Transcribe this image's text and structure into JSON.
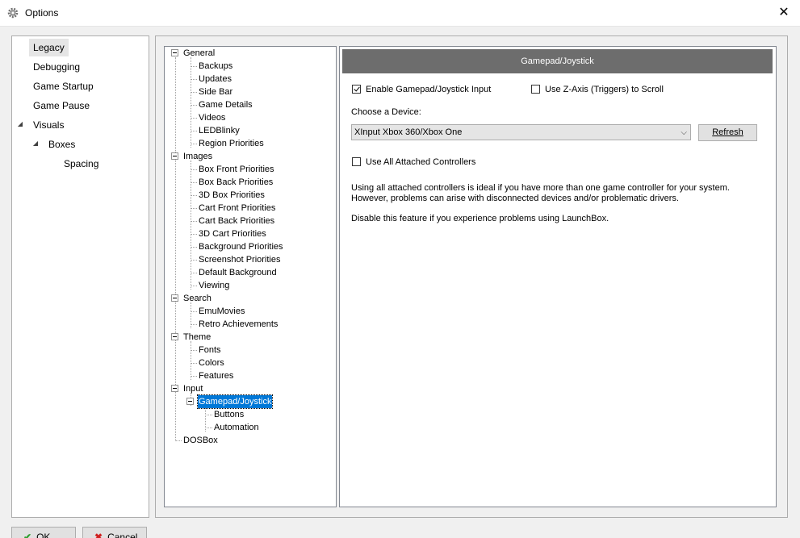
{
  "window": {
    "title": "Options",
    "close_symbol": "✕",
    "app_icon": "gear-icon"
  },
  "left_nav": {
    "items": [
      {
        "label": "Legacy",
        "selected": true
      },
      {
        "label": "Debugging"
      },
      {
        "label": "Game Startup"
      },
      {
        "label": "Game Pause"
      },
      {
        "label": "Visuals",
        "expanded": true
      },
      {
        "label": "Boxes",
        "expanded": true
      },
      {
        "label": "Spacing"
      }
    ]
  },
  "tree": {
    "nodes": [
      {
        "label": "General"
      },
      {
        "label": "Backups"
      },
      {
        "label": "Updates"
      },
      {
        "label": "Side Bar"
      },
      {
        "label": "Game Details"
      },
      {
        "label": "Videos"
      },
      {
        "label": "LEDBlinky"
      },
      {
        "label": "Region Priorities"
      },
      {
        "label": "Images"
      },
      {
        "label": "Box Front Priorities"
      },
      {
        "label": "Box Back Priorities"
      },
      {
        "label": "3D Box Priorities"
      },
      {
        "label": "Cart Front Priorities"
      },
      {
        "label": "Cart Back Priorities"
      },
      {
        "label": "3D Cart Priorities"
      },
      {
        "label": "Background Priorities"
      },
      {
        "label": "Screenshot Priorities"
      },
      {
        "label": "Default Background"
      },
      {
        "label": "Viewing"
      },
      {
        "label": "Search"
      },
      {
        "label": "EmuMovies"
      },
      {
        "label": "Retro Achievements"
      },
      {
        "label": "Theme"
      },
      {
        "label": "Fonts"
      },
      {
        "label": "Colors"
      },
      {
        "label": "Features"
      },
      {
        "label": "Input"
      },
      {
        "label": "Gamepad/Joystick",
        "selected": true
      },
      {
        "label": "Buttons"
      },
      {
        "label": "Automation"
      },
      {
        "label": "DOSBox"
      }
    ]
  },
  "panel": {
    "header": "Gamepad/Joystick",
    "enable_checkbox": {
      "label": "Enable Gamepad/Joystick Input",
      "checked": true
    },
    "zaxis_checkbox": {
      "label": "Use Z-Axis (Triggers) to Scroll",
      "checked": false
    },
    "device_label": "Choose a Device:",
    "device_value": "XInput Xbox 360/Xbox One",
    "refresh_label": "Refresh",
    "all_controllers_checkbox": {
      "label": "Use All Attached Controllers",
      "checked": false
    },
    "description_line1": "Using all attached controllers is ideal if you have more than one game controller for your system.",
    "description_line2": "However, problems can arise with disconnected devices and/or problematic drivers.",
    "description_line3": "Disable this feature if you experience problems using LaunchBox."
  },
  "footer": {
    "ok_label": "OK",
    "cancel_label": "Cancel"
  }
}
